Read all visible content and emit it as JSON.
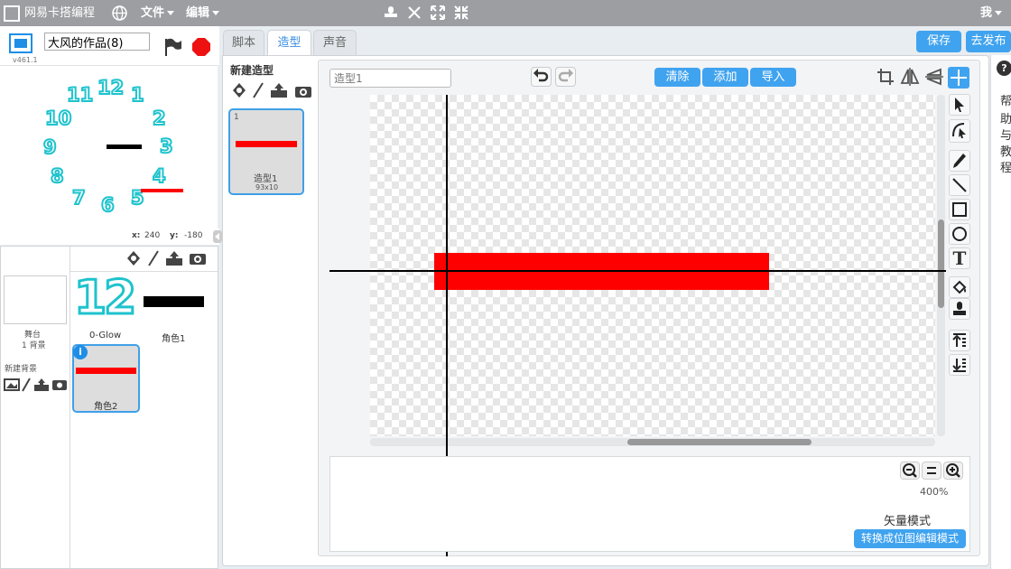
{
  "menubar": {
    "logo_text": "网易卡搭编程",
    "file_label": "文件",
    "edit_label": "编辑",
    "user_label": "我"
  },
  "stage": {
    "project_name": "大风的作品(8)",
    "version": "v461.1",
    "x_label": "x:",
    "x_value": "240",
    "y_label": "y:",
    "y_value": "-180",
    "clock_numbers": [
      "12",
      "1",
      "2",
      "3",
      "4",
      "5",
      "6",
      "7",
      "8",
      "9",
      "10",
      "11"
    ]
  },
  "sprites": {
    "stage_label": "舞台",
    "stage_backdrops": "1 背景",
    "new_backdrop_label": "新建背景",
    "items": [
      {
        "name": "0-Glow",
        "thumb_text": "12"
      },
      {
        "name": "角色1"
      },
      {
        "name": "角色2"
      }
    ]
  },
  "tabs": [
    "脚本",
    "造型",
    "声音"
  ],
  "top_buttons": {
    "save": "保存",
    "publish": "去发布"
  },
  "costumes": {
    "new_costume_label": "新建造型",
    "items": [
      {
        "index": "1",
        "name": "造型1",
        "size": "93x10"
      }
    ]
  },
  "editor": {
    "costume_name_placeholder": "造型1",
    "clear": "清除",
    "add": "添加",
    "import": "导入",
    "zoom": "400%",
    "mode_label": "矢量模式",
    "convert_button": "转换成位图编辑模式"
  },
  "help": {
    "icon": "?",
    "text": [
      "帮",
      "助",
      "与",
      "教",
      "程"
    ]
  },
  "colors": {
    "accent": "#40a3ef",
    "red": "#ff0000",
    "clock_cyan": "#1ec3cd"
  }
}
